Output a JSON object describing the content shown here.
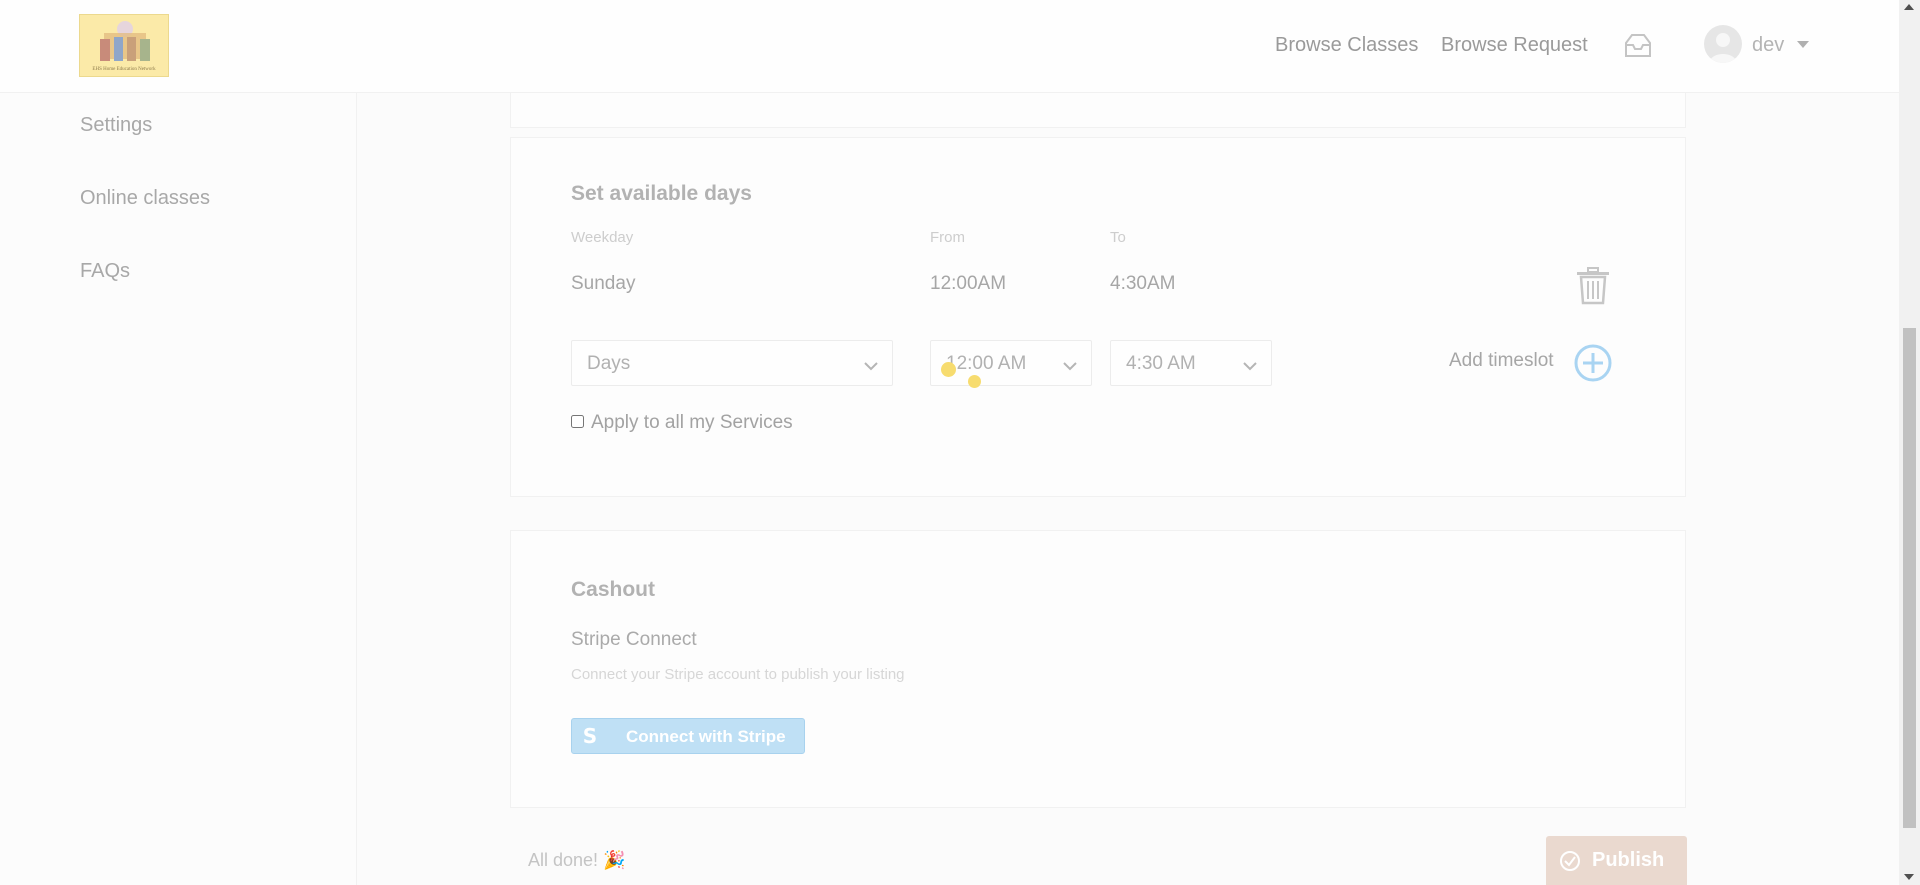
{
  "header": {
    "logo_caption": "EHS Home Education Network",
    "nav": {
      "browse_classes": "Browse Classes",
      "browse_request": "Browse Request"
    },
    "user": {
      "name": "dev"
    }
  },
  "sidebar": {
    "items": [
      {
        "label": "Settings"
      },
      {
        "label": "Online classes"
      },
      {
        "label": "FAQs"
      }
    ]
  },
  "available_days": {
    "title": "Set available days",
    "columns": {
      "weekday": "Weekday",
      "from": "From",
      "to": "To"
    },
    "rows": [
      {
        "weekday": "Sunday",
        "from": "12:00AM",
        "to": "4:30AM"
      }
    ],
    "form": {
      "days_select": "Days",
      "from_select": "12:00 AM",
      "to_select": "4:30 AM",
      "add_timeslot_label": "Add timeslot",
      "apply_all_label": "Apply to all my Services",
      "apply_all_checked": false
    }
  },
  "cashout": {
    "title": "Cashout",
    "subtitle": "Stripe Connect",
    "description": "Connect your Stripe account to publish your listing",
    "connect_button": "Connect with Stripe",
    "stripe_icon": "S"
  },
  "footer": {
    "all_done": "All done! 🎉",
    "publish_button": "Publish"
  },
  "colors": {
    "publish_bg": "#ead9cf",
    "stripe_bg": "#bfe0f5",
    "add_icon": "#a9d4f2",
    "cursor_dot": "#f7dc6f"
  }
}
